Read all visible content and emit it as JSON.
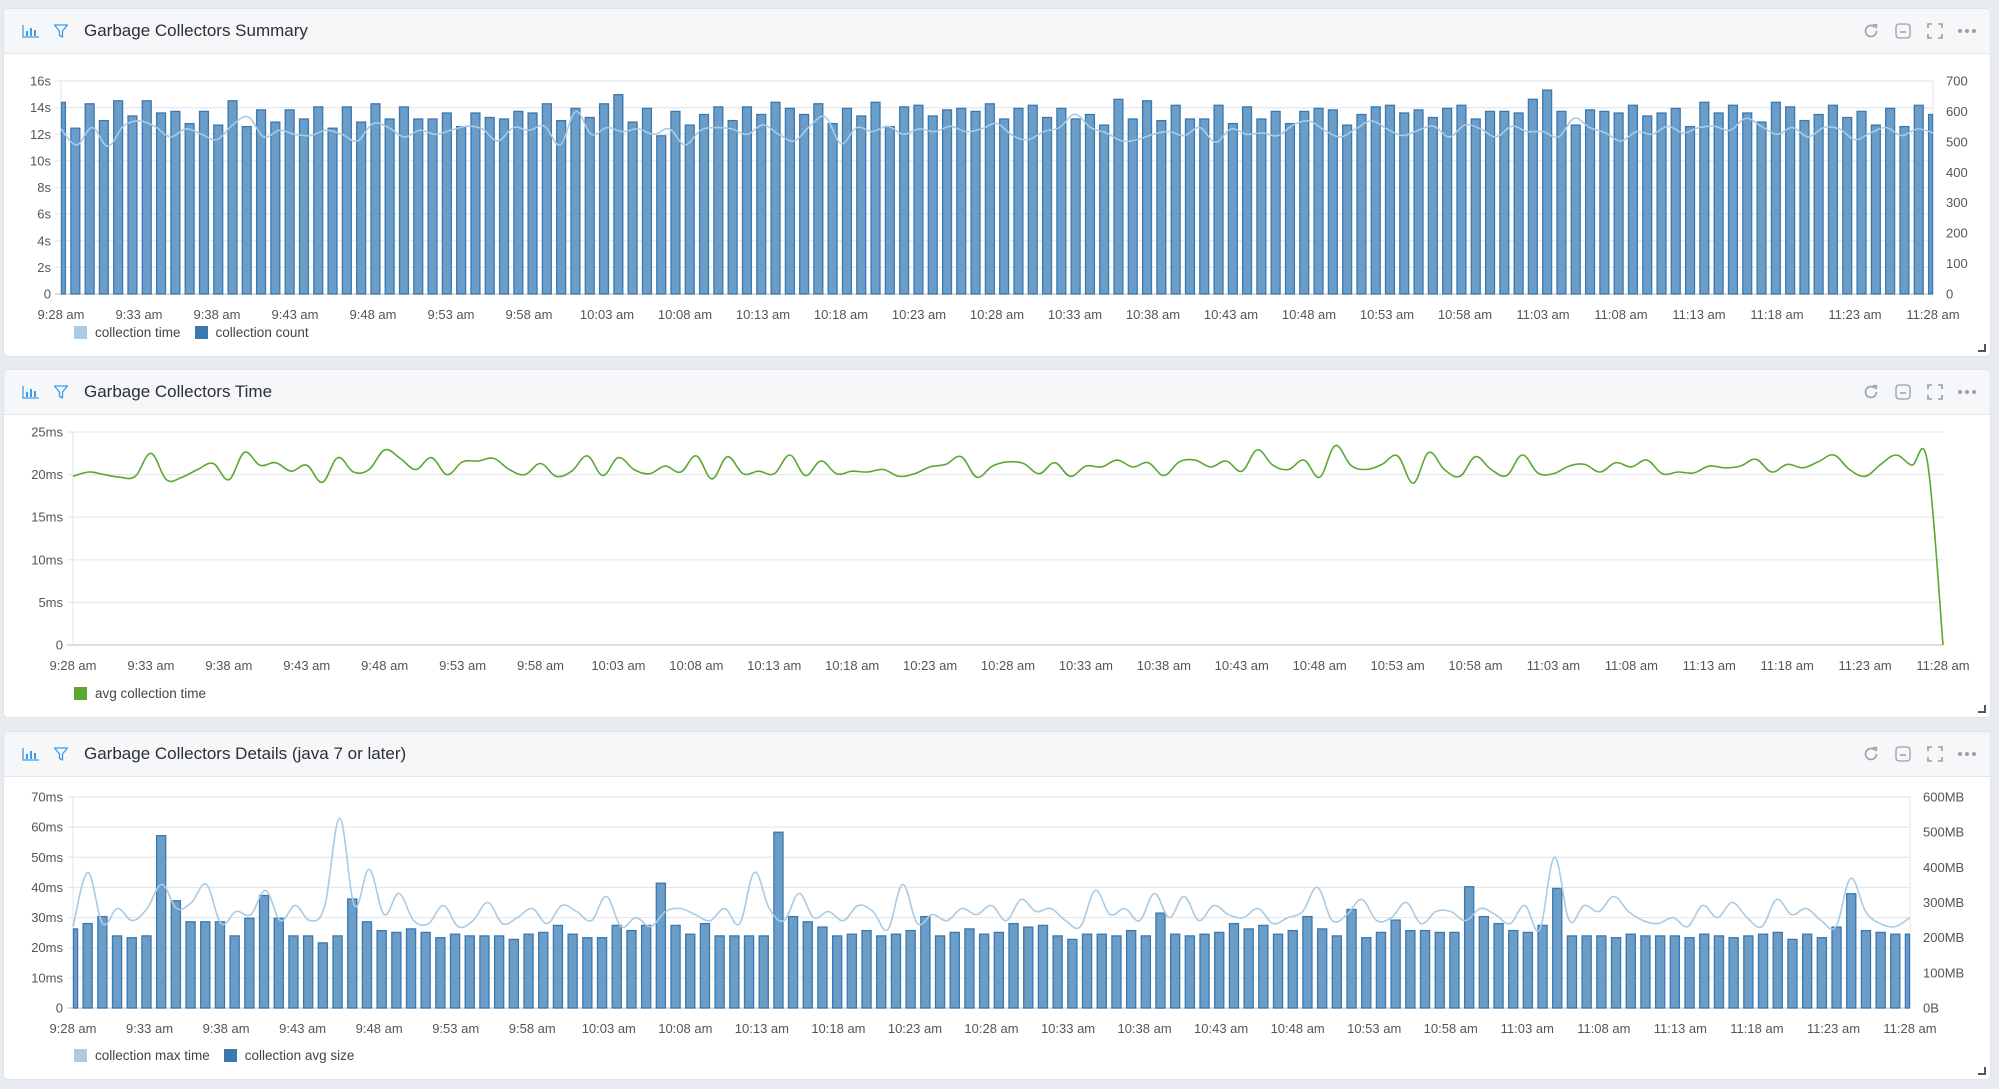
{
  "panels": [
    {
      "title": "Garbage Collectors Summary",
      "legend": [
        {
          "label": "collection time",
          "color": "#a9cbe4"
        },
        {
          "label": "collection count",
          "color": "#3a78b0"
        }
      ]
    },
    {
      "title": "Garbage Collectors Time",
      "legend": [
        {
          "label": "avg collection time",
          "color": "#5aa832"
        }
      ]
    },
    {
      "title": "Garbage Collectors Details (java 7 or later)",
      "legend": [
        {
          "label": "collection max time",
          "color": "#a9cbe4"
        },
        {
          "label": "collection avg size",
          "color": "#3a78b0"
        }
      ]
    }
  ],
  "actions": {
    "refresh": "refresh",
    "minimize": "minimize",
    "fullscreen": "fullscreen",
    "more": "more"
  },
  "colors": {
    "accent": "#3d9be9",
    "bar_fill": "#6b9dc8",
    "bar_stroke": "#3a78b0",
    "line_light": "#a9cbe4",
    "line_green": "#5aa832"
  },
  "chart_data": [
    {
      "type": "bar",
      "title": "Garbage Collectors Summary",
      "x_ticks": [
        "9:28 am",
        "9:33 am",
        "9:38 am",
        "9:43 am",
        "9:48 am",
        "9:53 am",
        "9:58 am",
        "10:03 am",
        "10:08 am",
        "10:13 am",
        "10:18 am",
        "10:23 am",
        "10:28 am",
        "10:33 am",
        "10:38 am",
        "10:43 am",
        "10:48 am",
        "10:53 am",
        "10:58 am",
        "11:03 am",
        "11:08 am",
        "11:13 am",
        "11:18 am",
        "11:23 am",
        "11:28 am"
      ],
      "x_range_minutes": [
        0,
        120
      ],
      "y_left": {
        "label": "collection time",
        "ticks": [
          "0",
          "2s",
          "4s",
          "6s",
          "8s",
          "10s",
          "12s",
          "14s",
          "16s"
        ],
        "range": [
          0,
          16
        ],
        "unit": "s"
      },
      "y_right": {
        "label": "collection count",
        "ticks": [
          "0",
          "100",
          "200",
          "300",
          "400",
          "500",
          "600",
          "700"
        ],
        "range": [
          0,
          700
        ]
      },
      "grid": true,
      "legend_position": "bottom-left",
      "series": [
        {
          "name": "collection time",
          "type": "line",
          "axis": "left",
          "values": [
            12.4,
            11.2,
            12.5,
            11.1,
            12.6,
            13.0,
            12.6,
            11.8,
            12.4,
            12.0,
            11.6,
            12.7,
            13.3,
            11.8,
            12.3,
            12.0,
            11.9,
            12.3,
            12.0,
            11.5,
            12.8,
            12.5,
            11.8,
            12.3,
            12.0,
            12.3,
            12.6,
            12.4,
            11.5,
            12.5,
            12.3,
            12.6,
            11.2,
            13.7,
            12.0,
            12.5,
            12.2,
            12.4,
            12.0,
            12.4,
            11.2,
            12.3,
            12.5,
            12.4,
            12.0,
            12.7,
            12.0,
            11.5,
            12.6,
            13.3,
            11.3,
            12.5,
            12.2,
            12.6,
            12.0,
            12.4,
            12.2,
            12.6,
            12.2,
            12.4,
            12.8,
            11.9,
            11.6,
            12.2,
            12.5,
            13.5,
            12.5,
            12.1,
            11.5,
            11.6,
            12.0,
            12.2,
            11.9,
            12.5,
            11.4,
            12.4,
            12.0,
            12.1,
            11.9,
            12.7,
            13.0,
            12.3,
            11.8,
            12.4,
            13.0,
            12.4,
            11.9,
            12.3,
            12.6,
            11.8,
            12.7,
            12.4,
            11.8,
            12.6,
            12.2,
            12.2,
            11.8,
            13.2,
            12.5,
            12.1,
            11.5,
            12.2,
            12.0,
            12.6,
            12.1,
            12.5,
            12.6,
            12.3,
            13.2,
            12.6,
            12.0,
            12.5,
            11.8,
            12.5,
            12.4,
            11.6,
            12.1,
            12.5,
            11.9,
            12.4,
            12.1
          ],
          "color": "#a9cbe4"
        },
        {
          "name": "collection count",
          "type": "bar",
          "axis": "right",
          "values": [
            630,
            545,
            625,
            570,
            635,
            585,
            635,
            595,
            600,
            560,
            600,
            555,
            635,
            550,
            605,
            565,
            605,
            575,
            615,
            545,
            615,
            565,
            625,
            575,
            615,
            575,
            575,
            595,
            550,
            595,
            580,
            575,
            600,
            595,
            625,
            570,
            610,
            580,
            625,
            655,
            565,
            610,
            520,
            600,
            555,
            590,
            615,
            570,
            615,
            590,
            630,
            610,
            590,
            625,
            560,
            610,
            585,
            630,
            550,
            615,
            620,
            585,
            605,
            610,
            600,
            625,
            575,
            610,
            620,
            580,
            610,
            575,
            590,
            555,
            640,
            575,
            635,
            570,
            620,
            575,
            575,
            620,
            560,
            615,
            575,
            600,
            560,
            600,
            610,
            605,
            555,
            590,
            615,
            620,
            595,
            605,
            580,
            610,
            620,
            575,
            600,
            600,
            595,
            640,
            670,
            600,
            555,
            605,
            600,
            595,
            620,
            585,
            595,
            610,
            550,
            630,
            595,
            620,
            595,
            565,
            630,
            615,
            570,
            590,
            620,
            580,
            600,
            555,
            610,
            550,
            620,
            590
          ],
          "color": "#3a78b0"
        }
      ]
    },
    {
      "type": "line",
      "title": "Garbage Collectors Time",
      "x_ticks": [
        "9:28 am",
        "9:33 am",
        "9:38 am",
        "9:43 am",
        "9:48 am",
        "9:53 am",
        "9:58 am",
        "10:03 am",
        "10:08 am",
        "10:13 am",
        "10:18 am",
        "10:23 am",
        "10:28 am",
        "10:33 am",
        "10:38 am",
        "10:43 am",
        "10:48 am",
        "10:53 am",
        "10:58 am",
        "11:03 am",
        "11:08 am",
        "11:13 am",
        "11:18 am",
        "11:23 am",
        "11:28 am"
      ],
      "x_range_minutes": [
        0,
        120
      ],
      "y_left": {
        "label": "avg collection time",
        "ticks": [
          "0",
          "5ms",
          "10ms",
          "15ms",
          "20ms",
          "25ms"
        ],
        "range": [
          0,
          25
        ],
        "unit": "ms"
      },
      "grid": true,
      "legend_position": "bottom-left",
      "series": [
        {
          "name": "avg collection time",
          "type": "line",
          "values": [
            19.8,
            20.3,
            20.0,
            19.7,
            19.8,
            22.5,
            19.4,
            19.7,
            20.6,
            21.3,
            19.4,
            22.6,
            21.1,
            21.4,
            20.4,
            21.1,
            19.1,
            22.0,
            20.3,
            20.6,
            22.9,
            21.9,
            20.6,
            22.0,
            20.0,
            21.5,
            21.6,
            21.9,
            20.6,
            20.0,
            21.3,
            19.8,
            20.4,
            22.2,
            19.9,
            22.0,
            20.6,
            20.1,
            21.0,
            20.3,
            22.2,
            19.5,
            22.1,
            20.1,
            20.4,
            20.1,
            22.3,
            19.9,
            21.6,
            20.1,
            20.4,
            20.3,
            20.6,
            19.8,
            20.1,
            20.9,
            21.2,
            22.1,
            19.7,
            21.0,
            21.5,
            21.3,
            20.1,
            21.4,
            19.8,
            21.0,
            20.9,
            21.7,
            20.9,
            21.4,
            19.9,
            21.5,
            21.7,
            20.9,
            21.6,
            20.4,
            22.9,
            21.1,
            20.6,
            21.7,
            19.7,
            23.4,
            21.1,
            20.6,
            21.2,
            22.2,
            19.0,
            22.6,
            20.6,
            19.8,
            22.1,
            20.6,
            19.9,
            22.3,
            20.2,
            20.1,
            21.0,
            21.2,
            20.3,
            21.4,
            20.9,
            21.7,
            20.1,
            20.3,
            20.2,
            21.0,
            20.8,
            21.0,
            21.8,
            20.3,
            21.2,
            20.8,
            21.5,
            22.3,
            20.6,
            19.8,
            21.2,
            22.3,
            21.1,
            21.5,
            0
          ],
          "color": "#5aa832"
        }
      ]
    },
    {
      "type": "bar",
      "title": "Garbage Collectors Details (java 7 or later)",
      "x_ticks": [
        "9:28 am",
        "9:33 am",
        "9:38 am",
        "9:43 am",
        "9:48 am",
        "9:53 am",
        "9:58 am",
        "10:03 am",
        "10:08 am",
        "10:13 am",
        "10:18 am",
        "10:23 am",
        "10:28 am",
        "10:33 am",
        "10:38 am",
        "10:43 am",
        "10:48 am",
        "10:53 am",
        "10:58 am",
        "11:03 am",
        "11:08 am",
        "11:13 am",
        "11:18 am",
        "11:23 am",
        "11:28 am"
      ],
      "x_range_minutes": [
        0,
        120
      ],
      "y_left": {
        "label": "collection max time",
        "ticks": [
          "0",
          "10ms",
          "20ms",
          "30ms",
          "40ms",
          "50ms",
          "60ms",
          "70ms"
        ],
        "range": [
          0,
          70
        ],
        "unit": "ms"
      },
      "y_right": {
        "label": "collection avg size",
        "ticks": [
          "0B",
          "100MB",
          "200MB",
          "300MB",
          "400MB",
          "500MB",
          "600MB"
        ],
        "range": [
          0,
          600
        ],
        "unit": "MB"
      },
      "grid": true,
      "legend_position": "bottom-left",
      "series": [
        {
          "name": "collection max time",
          "type": "line",
          "axis": "left",
          "values": [
            27,
            45,
            28,
            33,
            29,
            33,
            41,
            33,
            35,
            41,
            28,
            32,
            31,
            39,
            29,
            34,
            29,
            34,
            63,
            34,
            46,
            31,
            38,
            29,
            28,
            34,
            27,
            29,
            35,
            28,
            30,
            33,
            28,
            34,
            32,
            29,
            37,
            27,
            30,
            27,
            32,
            33,
            31,
            29,
            33,
            28,
            45,
            33,
            29,
            38,
            30,
            32,
            29,
            34,
            32,
            26,
            41,
            28,
            31,
            29,
            33,
            31,
            34,
            29,
            36,
            32,
            33,
            29,
            27,
            39,
            31,
            33,
            29,
            38,
            30,
            37,
            29,
            34,
            31,
            30,
            33,
            28,
            30,
            32,
            40,
            29,
            31,
            36,
            29,
            30,
            35,
            28,
            32,
            32,
            29,
            33,
            31,
            28,
            34,
            26,
            50,
            29,
            34,
            32,
            37,
            32,
            29,
            28,
            30,
            27,
            34,
            30,
            35,
            30,
            27,
            36,
            31,
            33,
            29,
            27,
            43,
            32,
            28,
            27,
            30
          ],
          "color": "#a9cbe4"
        },
        {
          "name": "collection avg size",
          "type": "bar",
          "axis": "right",
          "values": [
            225,
            240,
            260,
            205,
            200,
            205,
            490,
            305,
            245,
            245,
            245,
            205,
            255,
            320,
            255,
            205,
            205,
            185,
            205,
            310,
            245,
            220,
            215,
            225,
            215,
            200,
            210,
            205,
            205,
            205,
            195,
            210,
            215,
            235,
            210,
            200,
            200,
            235,
            220,
            235,
            355,
            235,
            210,
            240,
            205,
            205,
            205,
            205,
            500,
            260,
            245,
            230,
            205,
            210,
            220,
            205,
            210,
            220,
            260,
            205,
            215,
            225,
            210,
            215,
            240,
            230,
            235,
            205,
            195,
            210,
            210,
            205,
            220,
            205,
            270,
            210,
            205,
            210,
            215,
            240,
            225,
            235,
            210,
            220,
            260,
            225,
            205,
            280,
            200,
            215,
            250,
            220,
            220,
            215,
            215,
            345,
            260,
            240,
            220,
            215,
            235,
            340,
            205,
            205,
            205,
            200,
            210,
            205,
            205,
            205,
            200,
            210,
            205,
            200,
            205,
            210,
            215,
            195,
            210,
            200,
            230,
            325,
            220,
            215,
            210,
            210
          ],
          "color": "#3a78b0"
        }
      ]
    }
  ]
}
